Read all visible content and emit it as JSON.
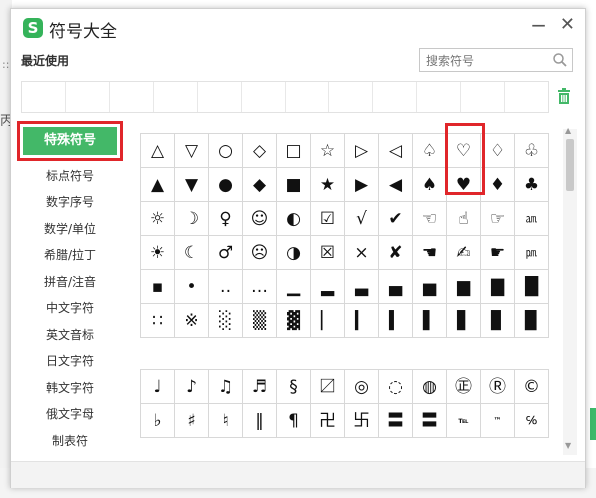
{
  "background": {
    "fragment1": "::",
    "fragment2": "丙"
  },
  "window": {
    "title": "符号大全",
    "logo": "S",
    "minimize": "−",
    "close": "✕"
  },
  "recent": {
    "label": "最近使用",
    "slots": 12
  },
  "search": {
    "placeholder": "搜索符号"
  },
  "sidebar": {
    "active": "特殊符号",
    "items": [
      "标点符号",
      "数字序号",
      "数学/单位",
      "希腊/拉丁",
      "拼音/注音",
      "中文字符",
      "英文音标",
      "日文字符",
      "韩文字符",
      "俄文字母",
      "制表符"
    ]
  },
  "grid1": [
    [
      "△",
      "▽",
      "○",
      "◇",
      "□",
      "☆",
      "▷",
      "◁",
      "♤",
      "♡",
      "♢",
      "♧"
    ],
    [
      "▲",
      "▼",
      "●",
      "◆",
      "■",
      "★",
      "▶",
      "◀",
      "♠",
      "♥",
      "♦",
      "♣"
    ],
    [
      "☼",
      "☽",
      "♀",
      "☺",
      "◐",
      "☑",
      "√",
      "✔",
      "☜",
      "☝",
      "☞",
      "㏂"
    ],
    [
      "☀",
      "☾",
      "♂",
      "☹",
      "◑",
      "☒",
      "×",
      "✘",
      "☚",
      "✍",
      "☛",
      "㏘"
    ],
    [
      "▪",
      "•",
      "‥",
      "…",
      "▁",
      "▂",
      "▃",
      "▄",
      "▅",
      "▆",
      "▇",
      "█"
    ],
    [
      "∷",
      "※",
      "░",
      "▒",
      "▓",
      "▏",
      "▎",
      "▍",
      "▌",
      "▋",
      "▊",
      "▉"
    ]
  ],
  "grid2": [
    [
      "♩",
      "♪",
      "♫",
      "♬",
      "§",
      "〼",
      "◎",
      "◌",
      "◍",
      "㊣",
      "Ⓡ",
      "©"
    ],
    [
      "♭",
      "♯",
      "♮",
      "‖",
      "¶",
      "卍",
      "卐",
      "〓",
      "〓",
      "℡",
      "™",
      "℅"
    ]
  ],
  "colors": {
    "accent": "#43b868",
    "highlight": "#e0262a"
  }
}
